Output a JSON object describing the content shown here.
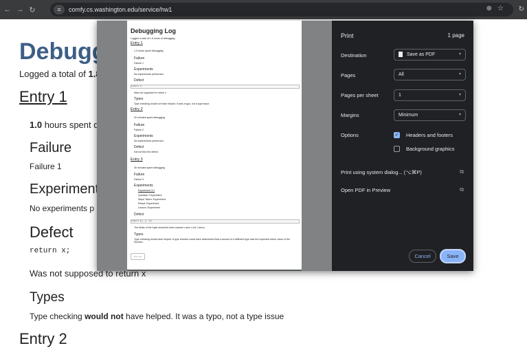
{
  "browser": {
    "url": "comfy.cs.washington.edu/service/hw1"
  },
  "page": {
    "title_visible": "Debugg",
    "logged_prefix": "Logged a total of",
    "logged_bold_visible": "1.8",
    "entry1": "Entry 1",
    "hours_bold": "1.0",
    "hours_rest_visible": " hours spent d",
    "failure_heading": "Failure",
    "failure_text": "Failure 1",
    "experiments_heading_visible": "Experiments",
    "no_experiments_visible": "No experiments p",
    "defect_heading": "Defect",
    "code": "return x;",
    "not_supposed": "Was not supposed to return x",
    "types_heading": "Types",
    "type_checking_prefix": "Type checking",
    "type_checking_bold": "would not",
    "type_checking_rest": " have helped. It was a typo, not a type issue",
    "entry2_partial": "Entry 2"
  },
  "preview": {
    "title": "Debugging Log",
    "logged": "Logged a total of 1.8 hours of debugging",
    "entry1": "Entry 1",
    "e1_hours": "1.0 hours spent debugging",
    "failure": "Failure",
    "failure1": "Failure 1",
    "experiments": "Experiments",
    "no_experiments": "No experiments performed.",
    "defect": "Defect",
    "code1": "return x;",
    "not_supposed": "Was not supposed to return x",
    "types": "Types",
    "types_text1": "Type checking would not have helped. It was a typo, not a type issue.",
    "entry2": "Entry 2",
    "e2_minutes": "20 minutes spent debugging",
    "failure2": "Failure 2",
    "no_experiments2": "No experiments performed.",
    "defect2_text": "Did not find the defect.",
    "entry3": "Entry 3",
    "e3_minutes": "30 minutes spent debugging",
    "failure3": "Failure 3",
    "experiment31": "Experiment 3.1",
    "question": "Question: Experiment",
    "steps": "Steps Taken: Experiment",
    "result": "Result: Experiment",
    "lesson": "Lesson: Experiment",
    "code3": "return [x, y, z];",
    "fields_text": "The fields of the tuple should've been named x and z not 1 and y.",
    "types_text3": "Type checking would have helped. A type checker could have determined that a second of a different type was the expected return value of the function.",
    "button": "Add new"
  },
  "print": {
    "title": "Print",
    "page_count": "1 page",
    "destination_label": "Destination",
    "destination_value": "Save as PDF",
    "pages_label": "Pages",
    "pages_value": "All",
    "pps_label": "Pages per sheet",
    "pps_value": "1",
    "margins_label": "Margins",
    "margins_value": "Minimum",
    "options_label": "Options",
    "headers_footers": "Headers and footers",
    "background_graphics": "Background graphics",
    "system_dialog": "Print using system dialog... (⌥⌘P)",
    "open_pdf": "Open PDF in Preview",
    "cancel": "Cancel",
    "save": "Save"
  }
}
